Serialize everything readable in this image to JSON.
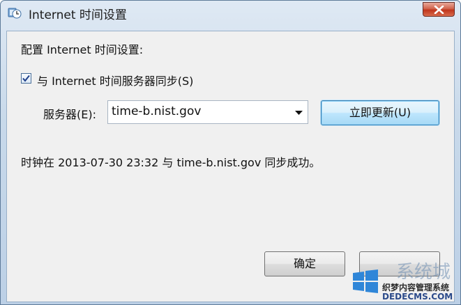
{
  "window": {
    "title": "Internet 时间设置",
    "title_icon": "clock-globe-icon",
    "close_icon": "close-icon"
  },
  "dialog": {
    "heading": "配置 Internet 时间设置:",
    "sync_checkbox": {
      "checked": true,
      "label": "与 Internet 时间服务器同步(S)"
    },
    "server_label": "服务器(E):",
    "server_value": "time-b.nist.gov",
    "update_button": "立即更新(U)",
    "status": "时钟在 2013-07-30 23:32 与 time-b.nist.gov 同步成功。",
    "ok_button": "确定",
    "cancel_button": ""
  },
  "watermark": {
    "brand": "系统城",
    "caption": "织梦内容管理系统",
    "url": "DEDECMS.COM"
  },
  "colors": {
    "accent": "#3c7fb1",
    "close_button": "#c0361c",
    "client_background": "#f0f0f0"
  }
}
